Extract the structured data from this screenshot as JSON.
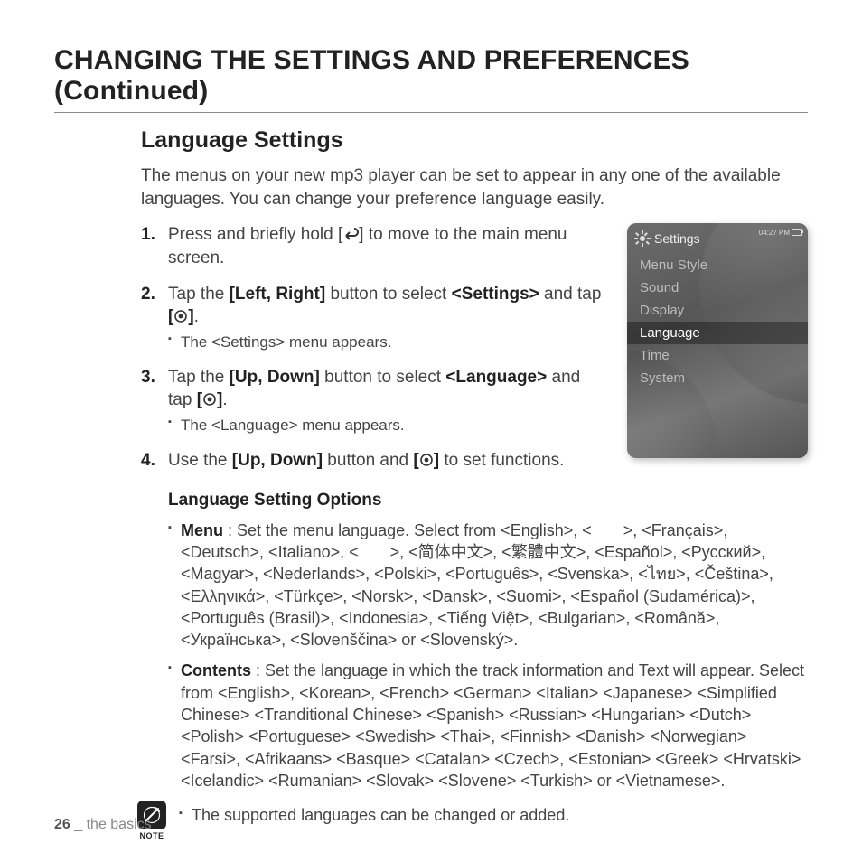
{
  "title": "CHANGING THE SETTINGS AND PREFERENCES (Continued)",
  "section": "Language Settings",
  "intro": "The menus on your new mp3 player can be set to appear in any one of the available languages. You can change your preference language easily.",
  "steps": {
    "s1a": "Press and briefly hold [",
    "s1b": "] to move to the main menu screen.",
    "s2a": "Tap the ",
    "s2b": "[Left, Right]",
    "s2c": " button to select ",
    "s2d": "<Settings>",
    "s2e": " and tap ",
    "s2f": "[",
    "s2g": "]",
    "s2h": ".",
    "s2sub": "The <Settings> menu appears.",
    "s3a": "Tap the ",
    "s3b": "[Up, Down]",
    "s3c": " button to select ",
    "s3d": "<Language>",
    "s3e": " and tap ",
    "s3f": "[",
    "s3g": "]",
    "s3h": ".",
    "s3sub": "The <Language> menu appears.",
    "s4a": "Use the ",
    "s4b": "[Up, Down]",
    "s4c": " button and ",
    "s4d": "[",
    "s4e": "]",
    "s4f": " to set functions."
  },
  "subhead": "Language Setting Options",
  "options": {
    "menu_label": "Menu",
    "menu_text": " : Set the menu language. Select from <English>, <       >, <Français>, <Deutsch>, <Italiano>, <       >, <简体中文>, <繁體中文>, <Español>, <Pусский>, <Magyar>, <Nederlands>, <Polski>, <Português>, <Svenska>, <ไทย>, <Čeština>, <Ελληνικά>, <Türkçe>, <Norsk>, <Dansk>, <Suomi>, <Español (Sudamérica)>, <Português (Brasil)>, <Indonesia>, <Tiếng Việt>, <Bulgarian>, <Română>, <Українська>, <Slovenščina> or <Slovenský>.",
    "contents_label": "Contents",
    "contents_text": " : Set the language in which the track information and Text will appear. Select from <English>, <Korean>, <French>  <German>   <Italian>   <Japanese>  <Simplified Chinese>   <Tranditional Chinese>   <Spanish>   <Russian>  <Hungarian>  <Dutch>   <Polish>  <Portuguese>  <Swedish>   <Thai>, <Finnish>  <Danish>  <Norwegian>  <Farsi>, <Afrikaans>  <Basque>  <Catalan>  <Czech>, <Estonian>  <Greek>  <Hrvatski>  <Icelandic>  <Rumanian>  <Slovak>  <Slovene>  <Turkish> or <Vietnamese>."
  },
  "note": {
    "label": "NOTE",
    "text": "The supported languages can be changed or added."
  },
  "device": {
    "title": "Settings",
    "time": "04:27 PM",
    "items": [
      "Menu Style",
      "Sound",
      "Display",
      "Language",
      "Time",
      "System"
    ],
    "selected_index": 3
  },
  "footer": {
    "page": "26",
    "sep": " _ ",
    "chapter": "the basics"
  }
}
